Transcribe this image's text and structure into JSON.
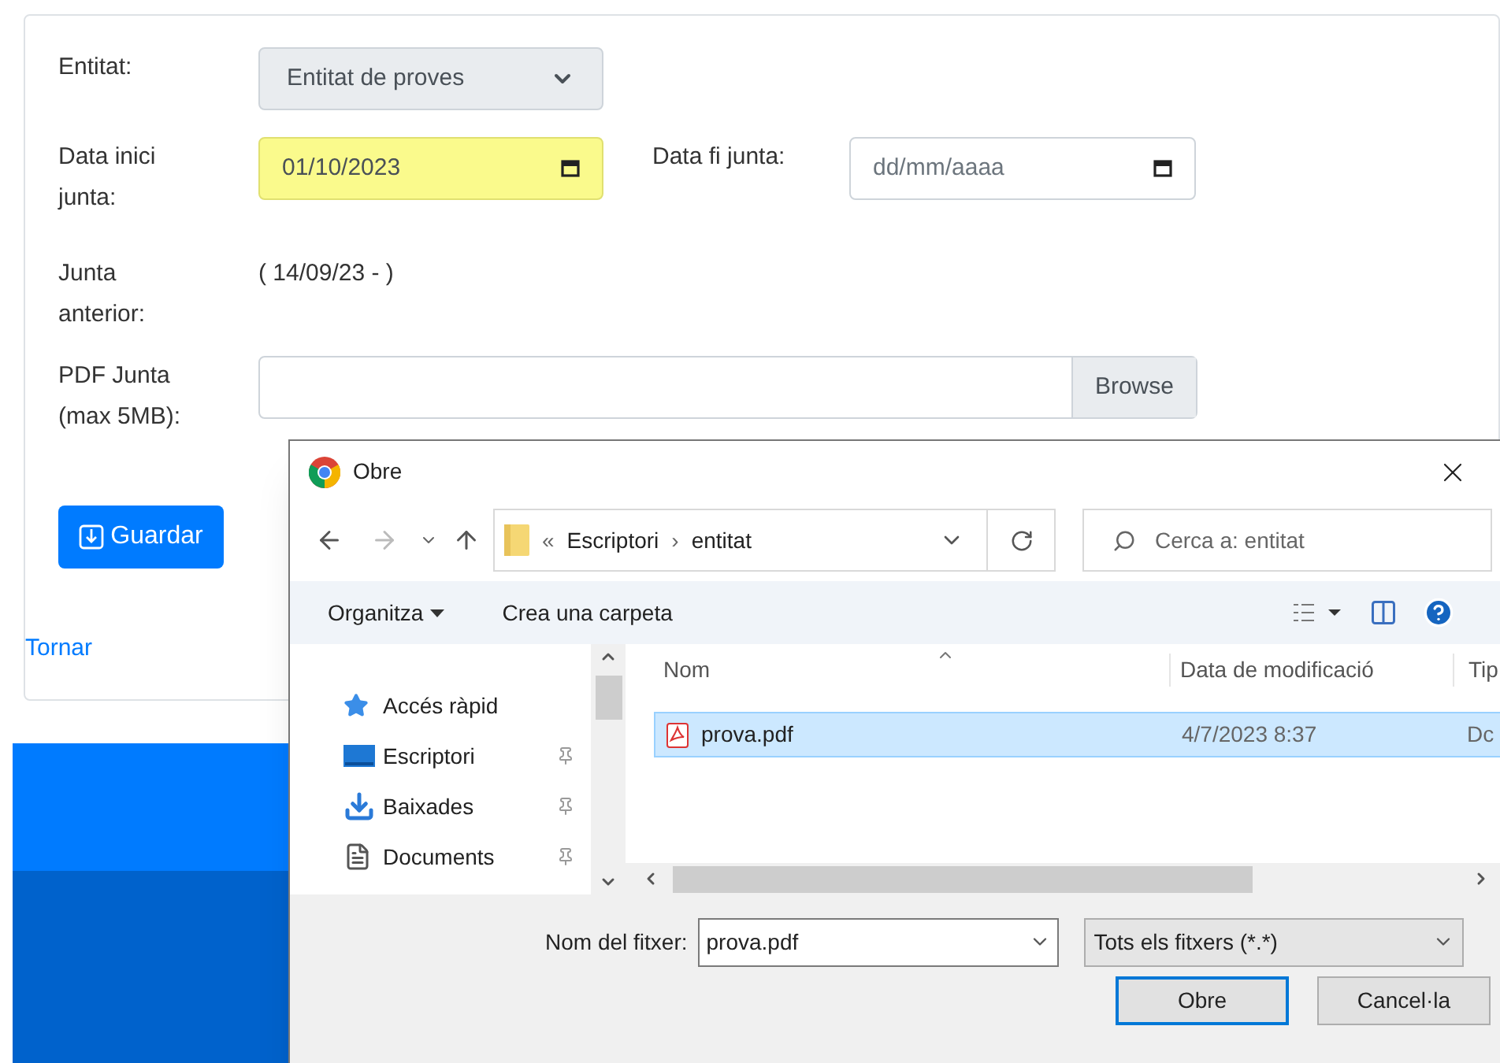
{
  "form": {
    "entity": {
      "label": "Entitat:",
      "value": "Entitat de proves"
    },
    "start": {
      "label": "Data inici junta:",
      "value": "01/10/2023",
      "autofilled": true
    },
    "end": {
      "label": "Data fi junta:",
      "placeholder": "dd/mm/aaaa"
    },
    "previous": {
      "label": "Junta anterior:",
      "value": "( 14/09/23 - )"
    },
    "pdf": {
      "label": "PDF Junta (max 5MB):",
      "button": "Browse"
    },
    "save": "Guardar",
    "back": "Tornar"
  },
  "dialog": {
    "title": "Obre",
    "address": [
      "«",
      "Escriptori",
      "›",
      "entitat"
    ],
    "search": {
      "placeholder": "Cerca a: entitat"
    },
    "toolbar": {
      "organize": "Organitza",
      "new_folder": "Crea una carpeta"
    },
    "nav_items": [
      {
        "label": "Accés ràpid",
        "kind": "star",
        "pinned": false
      },
      {
        "label": "Escriptori",
        "kind": "desktop",
        "pinned": true
      },
      {
        "label": "Baixades",
        "kind": "download",
        "pinned": true
      },
      {
        "label": "Documents",
        "kind": "document",
        "pinned": true
      }
    ],
    "columns": [
      "Nom",
      "Data de modificació",
      "Tip"
    ],
    "files": [
      {
        "name": "prova.pdf",
        "modified": "4/7/2023 8:37",
        "type": "Dc",
        "selected": true
      }
    ],
    "filename": {
      "label": "Nom del fitxer:",
      "value": "prova.pdf"
    },
    "filter": "Tots els fitxers (*.*)",
    "buttons": {
      "open": "Obre",
      "cancel": "Cancel·la"
    }
  }
}
